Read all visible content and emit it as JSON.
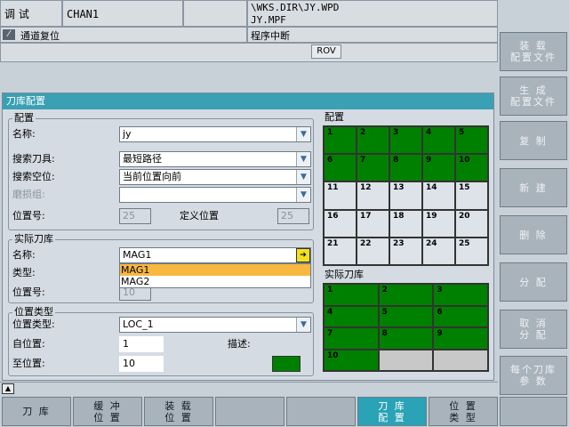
{
  "header": {
    "mode": "调 试",
    "channel": "CHAN1",
    "path": "\\WKS.DIR\\JY.WPD",
    "program": "JY.MPF",
    "status": "通道复位",
    "program_state": "程序中断",
    "rov": "ROV"
  },
  "right_softkeys": [
    {
      "line1": "装 载",
      "line2": "配置文件"
    },
    {
      "line1": "生 成",
      "line2": "配置文件"
    },
    {
      "line1": "复 制",
      "line2": ""
    },
    {
      "line1": "新 建",
      "line2": ""
    },
    {
      "line1": "删 除",
      "line2": ""
    },
    {
      "line1": "分 配",
      "line2": ""
    },
    {
      "line1": "取 消",
      "line2": "分 配"
    },
    {
      "line1": "每个刀库",
      "line2": "参 数"
    }
  ],
  "bottom_softkeys": [
    {
      "line1": "刀 库",
      "line2": ""
    },
    {
      "line1": "缓 冲",
      "line2": "位 置"
    },
    {
      "line1": "装 载",
      "line2": "位 置"
    },
    {
      "line1": "",
      "line2": ""
    },
    {
      "line1": "",
      "line2": ""
    },
    {
      "line1": "刀 库",
      "line2": "配 置"
    },
    {
      "line1": "位 置",
      "line2": "类 型"
    },
    {
      "line1": "",
      "line2": ""
    }
  ],
  "panel": {
    "title": "刀库配置",
    "config": {
      "group": "配置",
      "name_label": "名称:",
      "name_value": "jy",
      "search_tool_label": "搜索刀具:",
      "search_tool_value": "最短路径",
      "search_empty_label": "搜索空位:",
      "search_empty_value": "当前位置向前",
      "wear_group_label": "磨损组:",
      "wear_group_value": "",
      "position_label": "位置号:",
      "position_value": "25",
      "defined_position_label": "定义位置",
      "defined_position_value": "25"
    },
    "magazine": {
      "group": "实际刀库",
      "name_label": "名称:",
      "name_value": "MAG1",
      "type_label": "类型:",
      "position_label": "位置号:",
      "position_value": "10",
      "dropdown_options": [
        "MAG1",
        "MAG2"
      ],
      "selected_option": "MAG1"
    },
    "loc_type": {
      "group": "位置类型",
      "type_label": "位置类型:",
      "type_value": "LOC_1",
      "from_label": "自位置:",
      "from_value": "1",
      "to_label": "至位置:",
      "to_value": "10",
      "desc_label": "描述:",
      "desc_color": "#008000"
    },
    "config_grid": {
      "title": "配置",
      "cells": [
        "1",
        "2",
        "3",
        "4",
        "5",
        "6",
        "7",
        "8",
        "9",
        "10",
        "11",
        "12",
        "13",
        "14",
        "15",
        "16",
        "17",
        "18",
        "19",
        "20",
        "21",
        "22",
        "23",
        "24",
        "25"
      ],
      "assigned": [
        "1",
        "2",
        "3",
        "4",
        "5",
        "6",
        "7",
        "8",
        "9",
        "10"
      ]
    },
    "mag_grid": {
      "title": "实际刀库",
      "cells": [
        "1",
        "2",
        "3",
        "4",
        "5",
        "6",
        "7",
        "8",
        "9",
        "10",
        "",
        ""
      ],
      "assigned": [
        "1",
        "2",
        "3",
        "4",
        "5",
        "6",
        "7",
        "8",
        "9",
        "10"
      ]
    }
  },
  "colors": {
    "assigned": "#008000",
    "free": "#dde3e8",
    "accent": "#2aa3b6",
    "dropdown_highlight": "#f8b840"
  }
}
